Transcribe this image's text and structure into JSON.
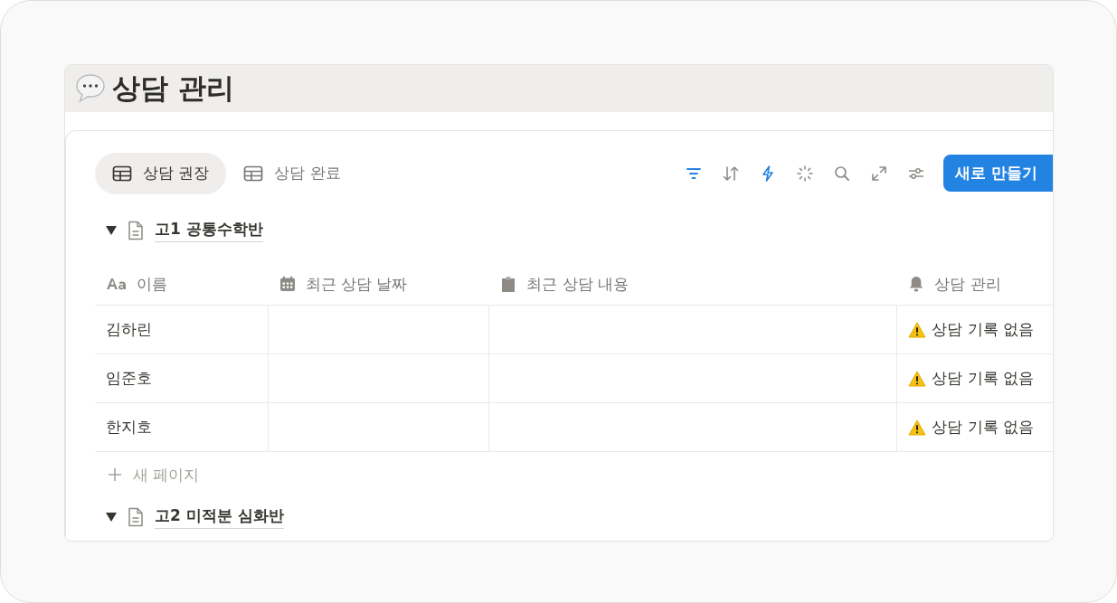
{
  "page": {
    "title": "상담 관리"
  },
  "views": [
    {
      "label": "상담 권장",
      "selected": true
    },
    {
      "label": "상담 완료",
      "selected": false
    }
  ],
  "toolbar": [
    {
      "kind": "filter",
      "active": true
    },
    {
      "kind": "sort",
      "active": false
    },
    {
      "kind": "automation",
      "active": true
    },
    {
      "kind": "ai",
      "active": false
    },
    {
      "kind": "search",
      "active": false
    },
    {
      "kind": "expand",
      "active": false
    },
    {
      "kind": "settings",
      "active": false
    }
  ],
  "new_button": "새로 만들기",
  "groups": [
    {
      "title": "고1 공통수학반",
      "expanded": true,
      "columns": [
        {
          "kind": "title",
          "label": "이름"
        },
        {
          "kind": "date",
          "label": "최근 상담 날짜"
        },
        {
          "kind": "text",
          "label": "최근 상담 내용"
        },
        {
          "kind": "status",
          "label": "상담 관리"
        }
      ],
      "rows": [
        {
          "name": "김하린",
          "status": "상담 기록 없음"
        },
        {
          "name": "임준호",
          "status": "상담 기록 없음"
        },
        {
          "name": "한지호",
          "status": "상담 기록 없음"
        }
      ],
      "add_label": "새 페이지"
    },
    {
      "title": "고2 미적분 심화반",
      "expanded": true
    }
  ]
}
